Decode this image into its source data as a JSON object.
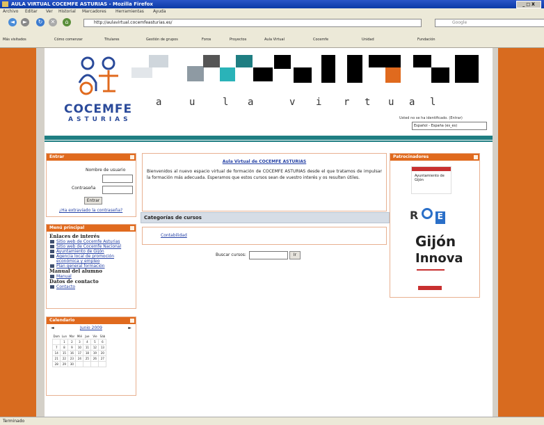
{
  "browser": {
    "title": "AULA VIRTUAL COCEMFE ASTURIAS - Mozilla Firefox",
    "window_controls": "_ □ X",
    "menu": [
      "Archivo",
      "Editar",
      "Ver",
      "Historial",
      "Marcadores",
      "Herramientas",
      "Ayuda"
    ],
    "url": "http://aulavirtual.cocemfeasturias.es/",
    "search_placeholder": "Google",
    "bookmarks": [
      "Más visitados",
      "Cómo comenzar",
      "Titulares",
      "Gestión de grupos",
      "Foros",
      "Proyectos",
      "Aula Virtual",
      "Cocemfe",
      "Unidad",
      "Fundación"
    ],
    "status": "Terminado"
  },
  "header": {
    "logo_line1": "COCEMFE",
    "logo_line2": "ASTURIAS",
    "aula_letters": [
      "a",
      "u",
      "l",
      "a",
      "v",
      "i",
      "r",
      "t",
      "u",
      "a",
      "l"
    ],
    "not_logged": "Usted no se ha identificado. (Entrar)",
    "language": "Español - España (es_es)"
  },
  "login": {
    "title": "Entrar",
    "username_label": "Nombre de usuario",
    "password_label": "Contraseña",
    "submit": "Entrar",
    "forgot": "¿Ha extraviado la contraseña?"
  },
  "mainmenu": {
    "title": "Menú principal",
    "sections": [
      {
        "heading": "Enlaces de interés",
        "items": [
          "Sitio web de Cocemfe Asturias",
          "Sitio web de Cocemfe Nacional",
          "Ayuntamiento de Gijón",
          "Agencia local de promoción económica y empleo",
          "Plan general formación"
        ]
      },
      {
        "heading": "Manual del alumno",
        "items": [
          "Manual"
        ]
      },
      {
        "heading": "Datos de contacto",
        "items": [
          "Contacto"
        ]
      }
    ]
  },
  "calendar": {
    "title": "Calendario",
    "month": "Junio 2009",
    "prev": "◄",
    "next": "►",
    "days": [
      "Dom",
      "Lun",
      "Mar",
      "Mié",
      "Jue",
      "Vie",
      "Sáb"
    ],
    "weeks": [
      [
        "",
        "1",
        "2",
        "3",
        "4",
        "5",
        "6"
      ],
      [
        "7",
        "8",
        "9",
        "10",
        "11",
        "12",
        "13"
      ],
      [
        "14",
        "15",
        "16",
        "17",
        "18",
        "19",
        "20"
      ],
      [
        "21",
        "22",
        "23",
        "24",
        "25",
        "26",
        "27"
      ],
      [
        "28",
        "29",
        "30",
        "",
        "",
        "",
        ""
      ]
    ]
  },
  "welcome": {
    "title": "Aula Virtual de COCEMFE ASTURIAS",
    "text": "Bienvenidos al nuevo espacio virtual de formación de COCEMFE ASTURIAS desde el que tratamos de impulsar la formación más adecuada. Esperamos que estos cursos sean de vuestro interés y os resulten útiles."
  },
  "categories": {
    "title": "Categorías de cursos",
    "items": [
      "Contabilidad"
    ]
  },
  "search": {
    "label": "Buscar cursos:",
    "button": "Ir"
  },
  "sponsors": {
    "title": "Patrocinadores",
    "gijon": "Gijón",
    "innova": "Innova",
    "gijon_small": "Ayuntamiento de Gijón"
  },
  "colors": {
    "accent": "#d86b1f",
    "teal": "#1f7e82"
  }
}
